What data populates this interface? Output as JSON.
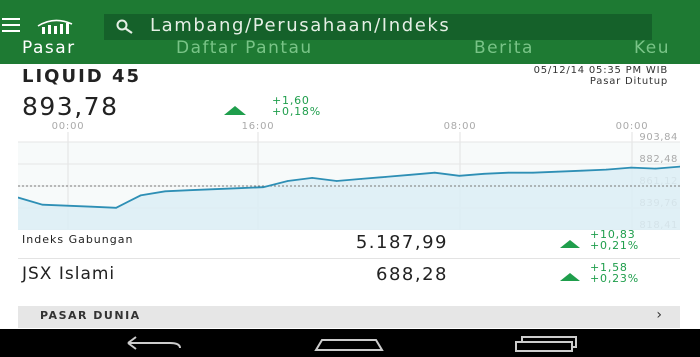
{
  "search": {
    "placeholder": "Lambang/Perusahaan/Indeks"
  },
  "tabs": [
    {
      "label": "Pasar",
      "active": true
    },
    {
      "label": "Daftar Pantau",
      "active": false
    },
    {
      "label": "Berita",
      "active": false
    },
    {
      "label": "Keu",
      "active": false
    }
  ],
  "index": {
    "name": "LIQUID 45",
    "timestamp": "05/12/14 05:35 PM WIB",
    "status": "Pasar Ditutup",
    "value": "893,78",
    "change": "+1,60",
    "change_pct": "+0,18%"
  },
  "chart_data": {
    "type": "area",
    "x_ticks": [
      "00:00",
      "16:00",
      "08:00",
      "00:00"
    ],
    "y_ticks": [
      "903,84",
      "882,48",
      "861,12",
      "839,76",
      "818,41"
    ],
    "ylim": [
      818.41,
      903.84
    ],
    "previous_close": 861.12,
    "x": [
      0,
      1,
      2,
      3,
      4,
      5,
      6,
      7,
      8,
      9,
      10,
      11,
      12,
      13,
      14,
      15,
      16,
      17,
      18,
      19,
      20,
      21,
      22,
      23,
      24,
      25,
      26,
      27
    ],
    "y": [
      850,
      843,
      842,
      841,
      840,
      852,
      856,
      857,
      858,
      859,
      860,
      866,
      869,
      866,
      868,
      870,
      872,
      874,
      871,
      873,
      874,
      874,
      875,
      876,
      877,
      879,
      878,
      880
    ],
    "grid": true
  },
  "rows": [
    {
      "name": "Indeks Gabungan",
      "value": "5.187,99",
      "change": "+10,83",
      "change_pct": "+0,21%"
    },
    {
      "name": "JSX Islami",
      "value": "688,28",
      "change": "+1,58",
      "change_pct": "+0,23%"
    }
  ],
  "section": {
    "label": "PASAR DUNIA"
  },
  "colors": {
    "appbar": "#1e7a33",
    "accent": "#1f9e4c",
    "chart_line": "#2e8fb5",
    "chart_fill": "#dcedf4"
  },
  "icons": [
    "menu-icon",
    "brand-icon",
    "search-icon",
    "chevron-right-icon",
    "back-icon",
    "home-icon",
    "recents-icon"
  ]
}
